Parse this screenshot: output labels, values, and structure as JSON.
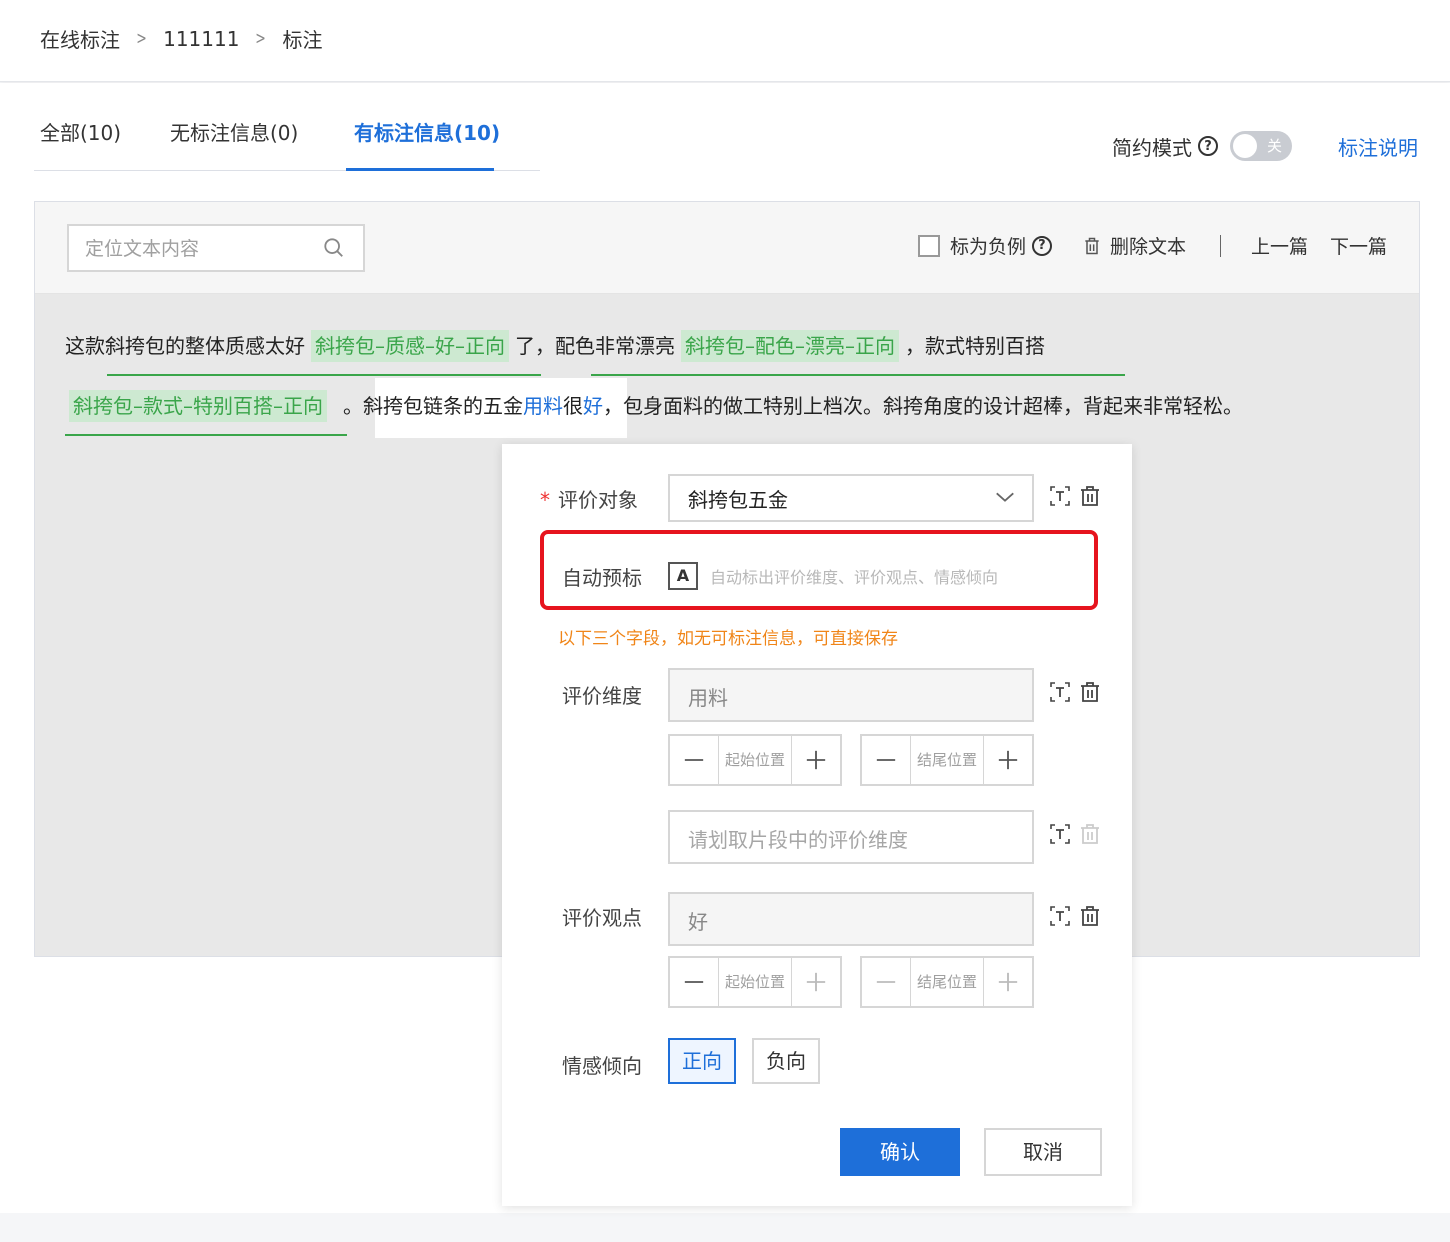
{
  "breadcrumb": {
    "items": [
      "在线标注",
      "111111",
      "标注"
    ],
    "separator": ">"
  },
  "tabs": [
    {
      "label": "全部(10)"
    },
    {
      "label": "无标注信息(0)"
    },
    {
      "label": "有标注信息(10)",
      "active": true
    }
  ],
  "header_right": {
    "mode_label": "简约模式",
    "switch_text": "关",
    "help_link": "标注说明"
  },
  "toolbar": {
    "search_placeholder": "定位文本内容",
    "mark_negative": "标为负例",
    "delete_text": "删除文本",
    "prev": "上一篇",
    "next": "下一篇"
  },
  "text": {
    "line1": {
      "t1": "这款斜挎包的整体质感太好",
      "tag1": "斜挎包–质感–好–正向",
      "t2": "了，配色非常漂亮",
      "tag2": "斜挎包–配色–漂亮–正向",
      "t3": "，款式特别百搭"
    },
    "line2": {
      "tag3": "斜挎包–款式–特别百搭–正向",
      "t4": "。斜挎包链条的五金",
      "t5": "用料",
      "t6": "很",
      "t7": "好",
      "t8": "，包身面料的做工特别上档次。斜挎角度的设计超棒，背起来非常轻松。"
    }
  },
  "popup": {
    "required_mark": "*",
    "object_label": "评价对象",
    "object_value": "斜挎包五金",
    "auto_label": "自动预标",
    "auto_icon": "A",
    "auto_hint": "自动标出评价维度、评价观点、情感倾向",
    "notice": "以下三个字段，如无可标注信息，可直接保存",
    "dimension_label": "评价维度",
    "dimension_value": "用料",
    "start_pos": "起始位置",
    "end_pos": "结尾位置",
    "dimension_placeholder": "请划取片段中的评价维度",
    "opinion_label": "评价观点",
    "opinion_value": "好",
    "sentiment_label": "情感倾向",
    "positive": "正向",
    "negative": "负向",
    "confirm": "确认",
    "cancel": "取消"
  },
  "colors": {
    "accent": "#1e6fd9",
    "tag_green": "#3aa54a",
    "tag_bg": "#cde9d1",
    "highlight_red": "#e6141e",
    "notice_orange": "#f08518"
  }
}
